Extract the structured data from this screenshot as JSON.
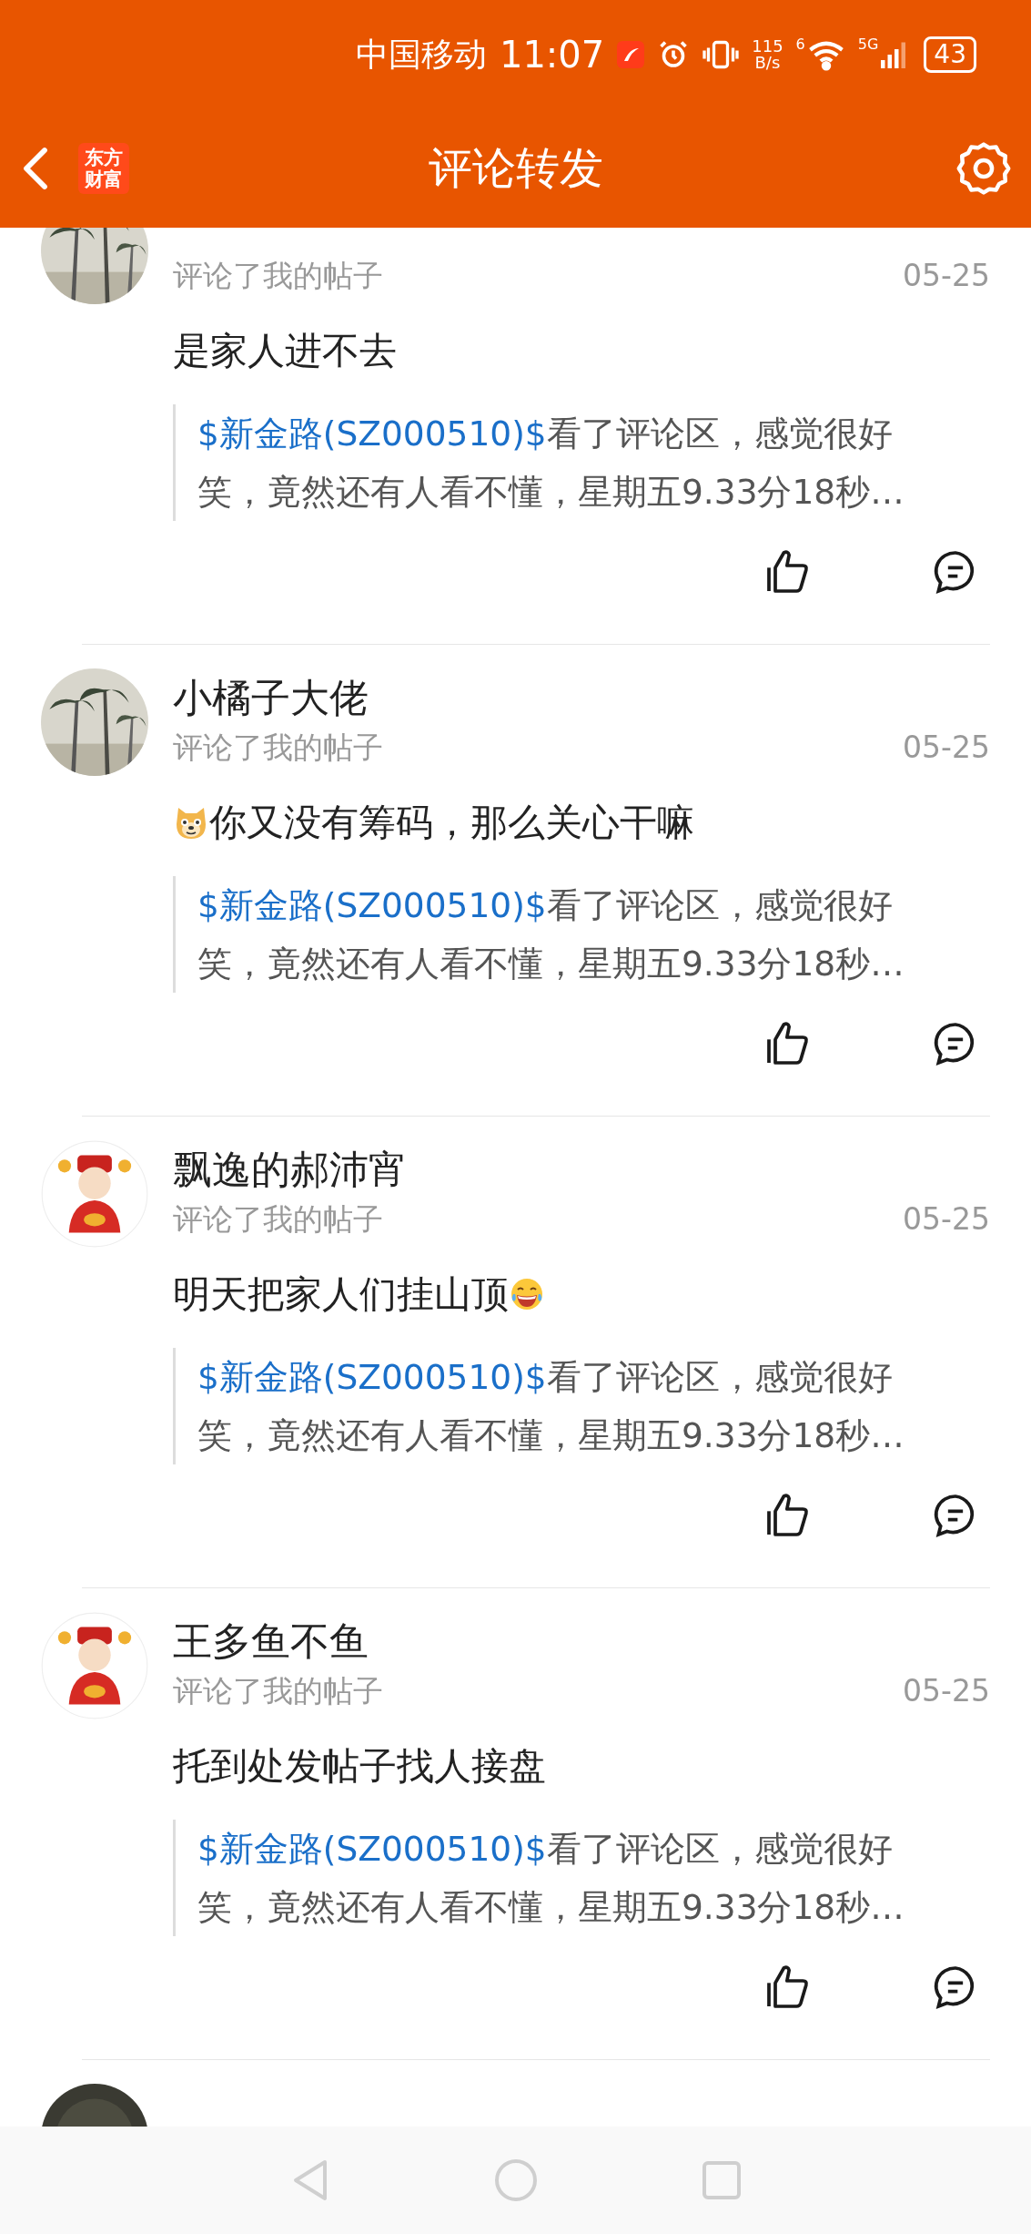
{
  "status_bar": {
    "carrier": "中国移动",
    "time": "11:07",
    "net_speed_value": "115",
    "net_speed_unit": "B/s",
    "wifi_label": "6",
    "signal_label": "5G",
    "battery": "43"
  },
  "header": {
    "title": "评论转发",
    "logo_lines": [
      "东方",
      "财富"
    ]
  },
  "comments": [
    {
      "action": "评论了我的帖子",
      "date": "05-25",
      "text": "是家人进不去",
      "quote": {
        "tag": "$新金路(SZ000510)$",
        "text": "看了评论区，感觉很好笑，竟然还有人看不懂，星期五9.33分18秒…"
      }
    },
    {
      "name": "小橘子大佬",
      "action": "评论了我的帖子",
      "date": "05-25",
      "leading_emoji": {
        "kind": "dog"
      },
      "text": "你又没有筹码，那么关心干嘛",
      "quote": {
        "tag": "$新金路(SZ000510)$",
        "text": "看了评论区，感觉很好笑，竟然还有人看不懂，星期五9.33分18秒…"
      }
    },
    {
      "avatar": {
        "kind": "figure"
      },
      "name": "飘逸的郝沛宵",
      "action": "评论了我的帖子",
      "date": "05-25",
      "trailing_emoji": {
        "kind": "laughing"
      },
      "text": "明天把家人们挂山顶",
      "quote": {
        "tag": "$新金路(SZ000510)$",
        "text": "看了评论区，感觉很好笑，竟然还有人看不懂，星期五9.33分18秒…"
      }
    },
    {
      "avatar": {
        "kind": "figure"
      },
      "name": "王多鱼不鱼",
      "action": "评论了我的帖子",
      "date": "05-25",
      "text": "托到处发帖子找人接盘",
      "quote": {
        "tag": "$新金路(SZ000510)$",
        "text": "看了评论区，感觉很好笑，竟然还有人看不懂，星期五9.33分18秒…"
      }
    },
    {
      "avatar": {
        "kind": "dark"
      }
    }
  ]
}
